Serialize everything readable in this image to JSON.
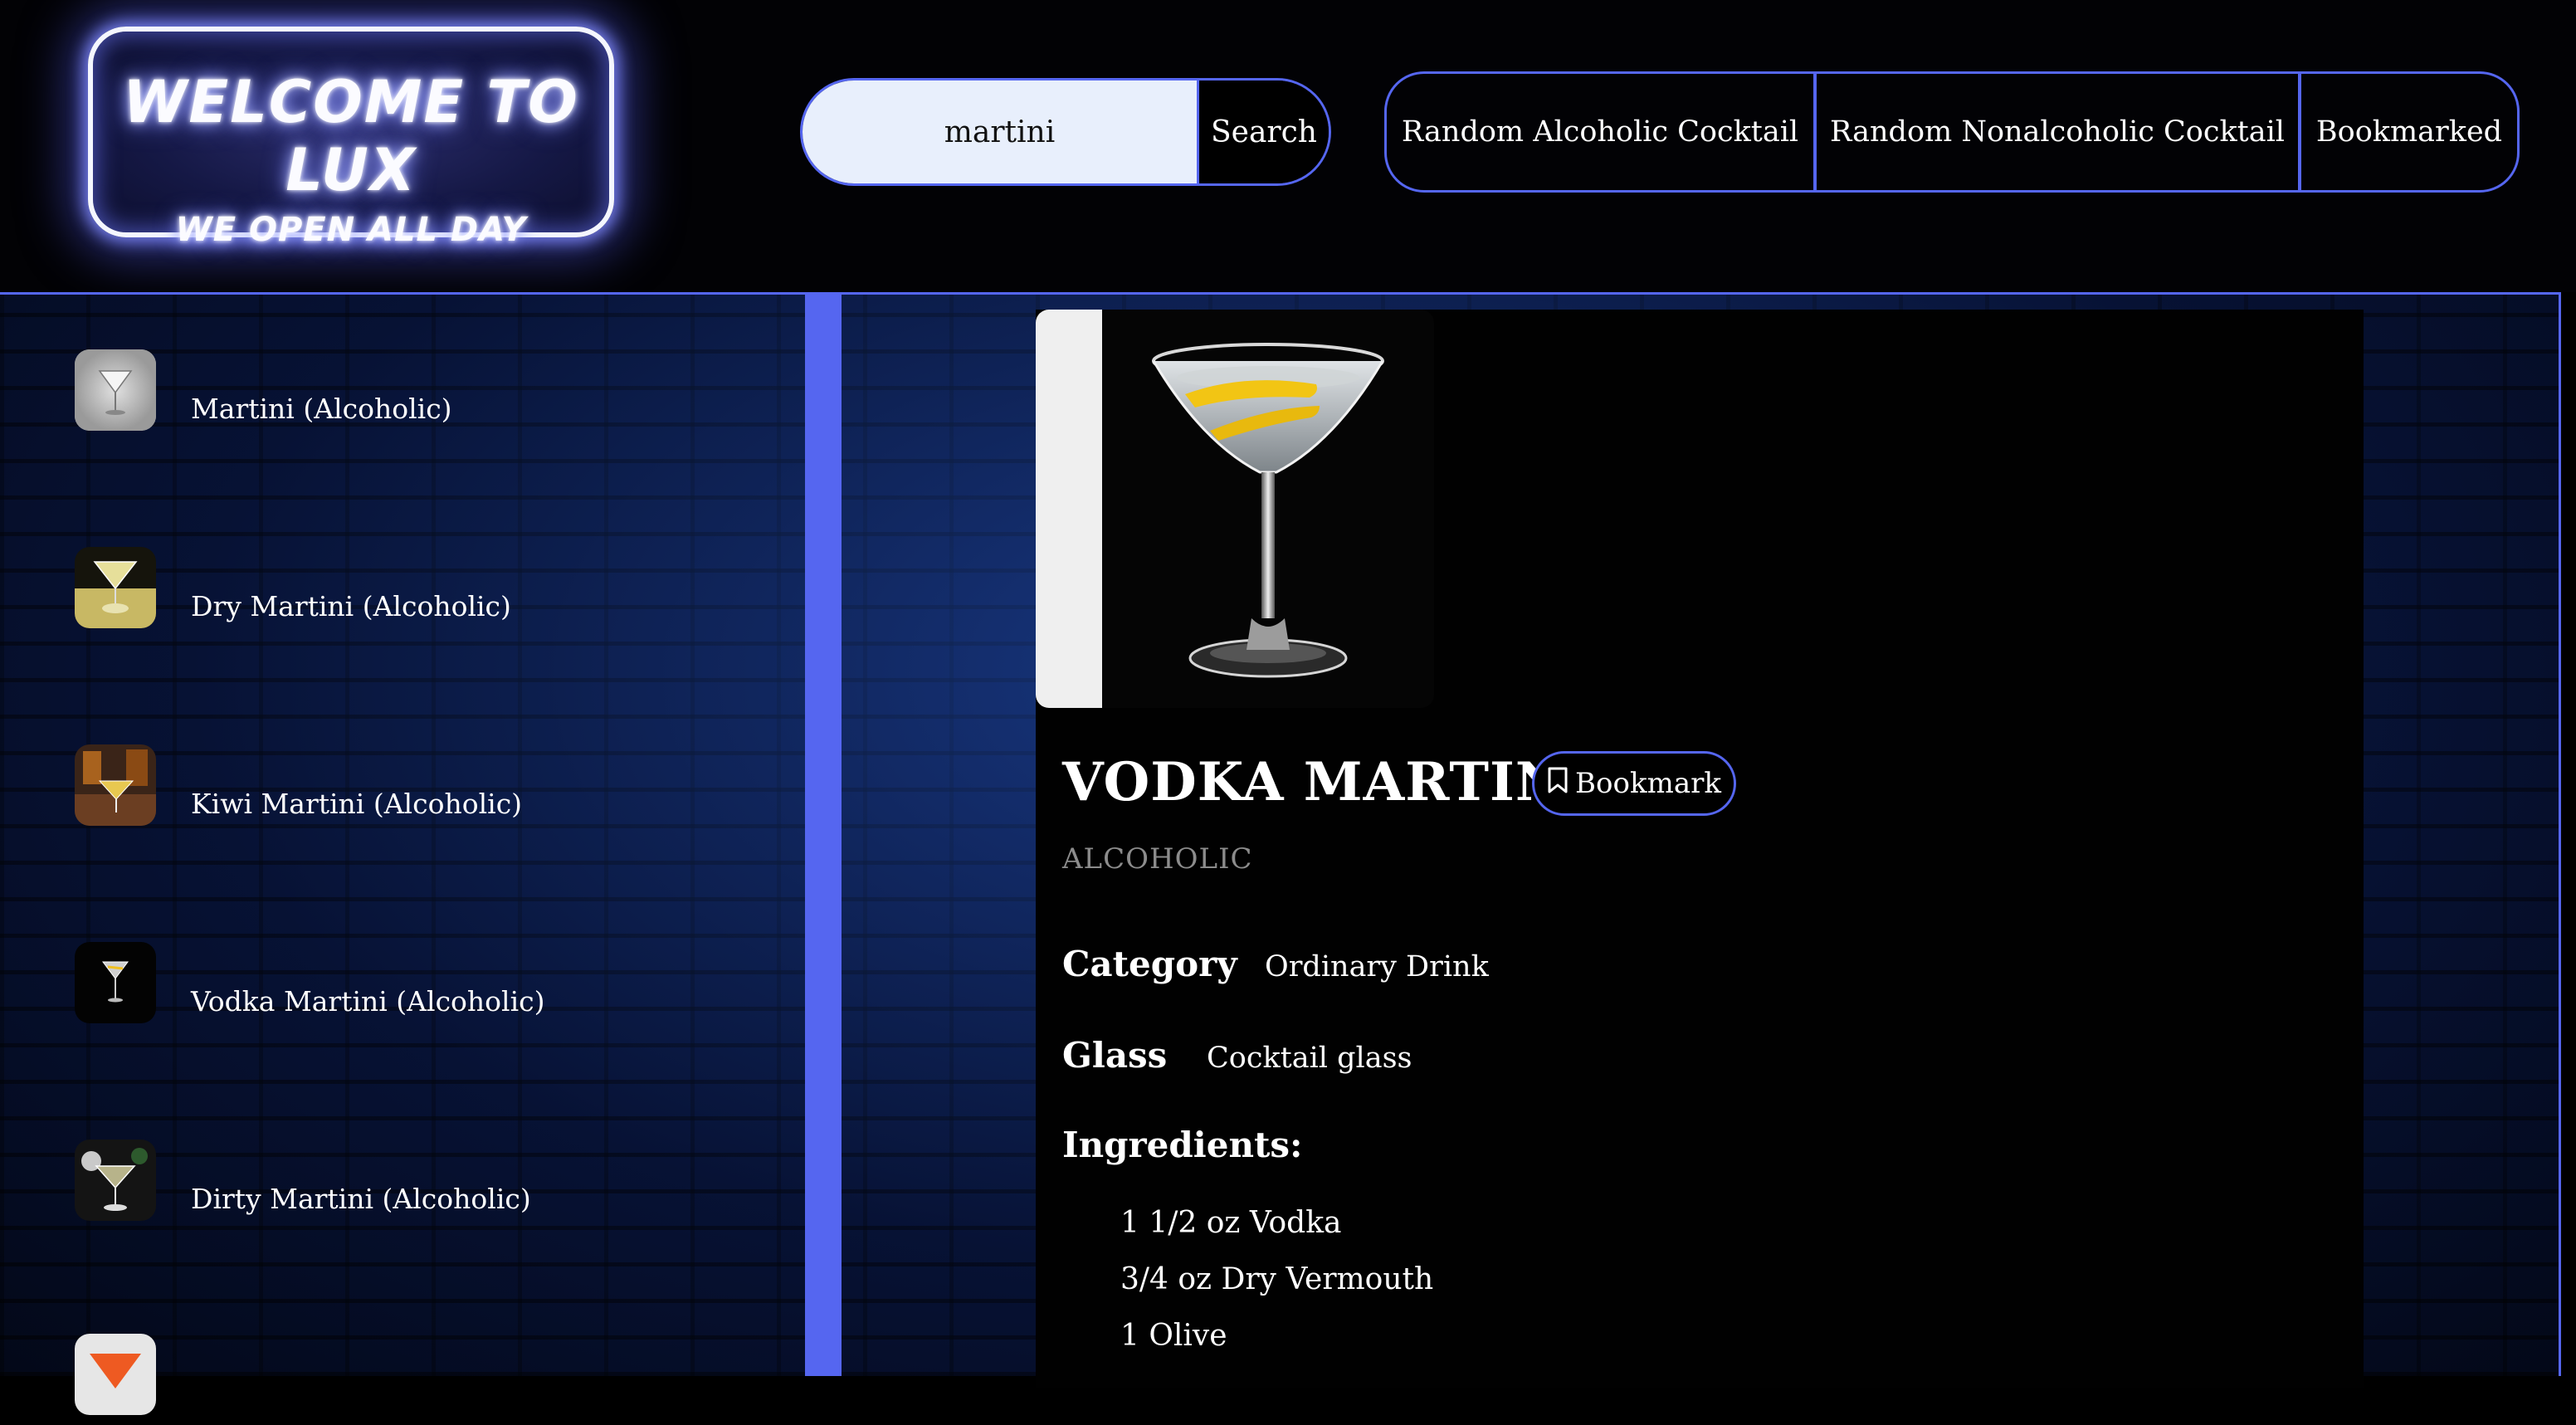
{
  "logo": {
    "title": "WELCOME TO LUX",
    "subtitle": "WE OPEN ALL DAY"
  },
  "search": {
    "value": "martini",
    "button_label": "Search"
  },
  "nav": {
    "random_alcoholic": "Random Alcoholic Cocktail",
    "random_nonalcoholic": "Random Nonalcoholic Cocktail",
    "bookmarked": "Bookmarked"
  },
  "results": [
    {
      "label": "Martini (Alcoholic)"
    },
    {
      "label": "Dry Martini (Alcoholic)"
    },
    {
      "label": "Kiwi Martini (Alcoholic)"
    },
    {
      "label": "Vodka Martini (Alcoholic)"
    },
    {
      "label": "Dirty Martini (Alcoholic)"
    }
  ],
  "detail": {
    "title": "VODKA MARTINI",
    "bookmark_label": "Bookmark",
    "alcoholic": "ALCOHOLIC",
    "category_label": "Category",
    "category_value": "Ordinary Drink",
    "glass_label": "Glass",
    "glass_value": "Cocktail glass",
    "ingredients_label": "Ingredients:",
    "ingredients": [
      "1 1/2 oz Vodka",
      "3/4 oz Dry Vermouth",
      "1 Olive"
    ]
  },
  "colors": {
    "accent": "#5566f0",
    "neon_glow": "#7a84ff",
    "search_bg": "#e8effc"
  }
}
